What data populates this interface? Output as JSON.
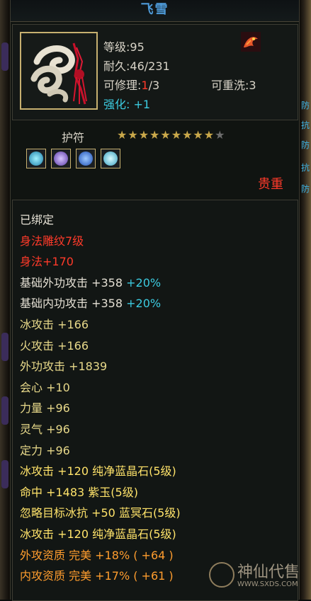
{
  "title": "飞雪",
  "header": {
    "level_label": "等级",
    "level_value": ":95",
    "durability_label": "耐久",
    "durability_value": ":46/231",
    "repair_label": "可修理",
    "repair_sep": ":",
    "repair_current": "1",
    "repair_total": "/3",
    "rewash_label": "可重洗",
    "rewash_value": ":3",
    "enhance_label": "强化:",
    "enhance_value": " +1"
  },
  "amulet": {
    "label": "护符",
    "stars_filled": 9,
    "stars_total": 10
  },
  "gems": [
    "blue-gem-icon",
    "purple-gem-icon",
    "sapphire-gem-icon",
    "ice-gem-icon"
  ],
  "rarity": "贵重",
  "attributes": [
    {
      "text": "已绑定",
      "color": "white"
    },
    {
      "text": "身法雕纹7级",
      "color": "red"
    },
    {
      "text": "身法+170",
      "color": "red"
    },
    {
      "text": "基础外功攻击 +358",
      "extra": " +20%",
      "color": "white"
    },
    {
      "text": "基础内功攻击 +358",
      "extra": " +20%",
      "color": "white"
    },
    {
      "text": "冰攻击 +166",
      "color": "yellow"
    },
    {
      "text": "火攻击 +166",
      "color": "yellow"
    },
    {
      "text": "外功攻击 +1839",
      "color": "yellow"
    },
    {
      "text": "会心 +10",
      "color": "yellow"
    },
    {
      "text": "力量 +96",
      "color": "yellow"
    },
    {
      "text": "灵气 +96",
      "color": "yellow"
    },
    {
      "text": "定力 +96",
      "color": "yellow"
    },
    {
      "text": "冰攻击 +120 纯净蓝晶石(5级)",
      "color": "gem"
    },
    {
      "text": "命中 +1483 紫玉(5级)",
      "color": "gem"
    },
    {
      "text": "忽略目标冰抗 +50 蓝冥石(5级)",
      "color": "gem"
    },
    {
      "text": "冰攻击 +120 纯净蓝晶石(5级)",
      "color": "gem"
    },
    {
      "text": "外攻资质  完美 +18% ( +64 )",
      "color": "orange"
    },
    {
      "text": "内攻资质  完美 +17% ( +61 )",
      "color": "orange"
    }
  ],
  "watermark": {
    "title": "神仙代售",
    "url": "WWW.SXDS.COM"
  },
  "side_glyphs": [
    "防",
    "抗",
    "防",
    "抗",
    "防"
  ],
  "colors": {
    "accent_blue": "#4e9ad8",
    "red": "#ff3a2a",
    "cyan": "#3ccbe0",
    "gold": "#c9a84a"
  }
}
